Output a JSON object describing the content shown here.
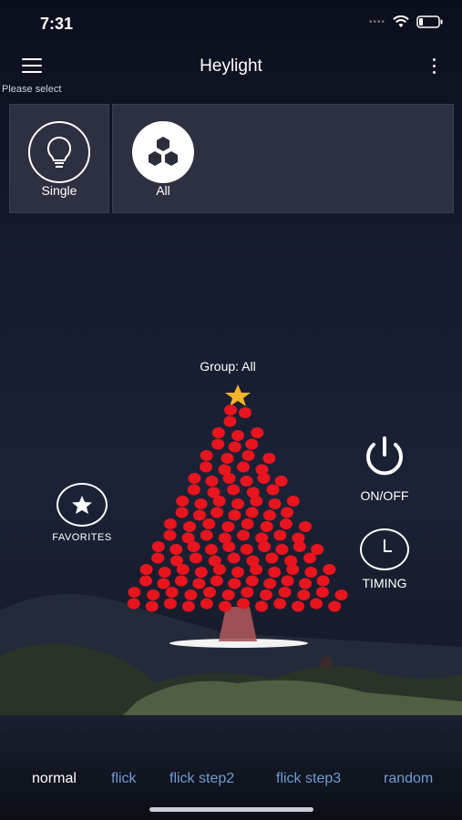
{
  "status_bar": {
    "time": "7:31"
  },
  "header": {
    "title": "Heylight",
    "subtitle": "Please select"
  },
  "groups": [
    {
      "label": "Single",
      "icon": "lightbulb-icon"
    },
    {
      "label": "All",
      "icon": "hexagon-cluster-icon"
    }
  ],
  "main": {
    "group_label": "Group: All"
  },
  "controls": {
    "favorites": "FAVORITES",
    "power": "ON/OFF",
    "timing": "TIMING"
  },
  "modes": {
    "items": [
      "normal",
      "flick",
      "flick step2",
      "flick step3",
      "random"
    ],
    "active": "normal"
  },
  "colors": {
    "accent": "#6f9bd6",
    "bulb": "#e8141e",
    "star": "#f3b42a"
  }
}
